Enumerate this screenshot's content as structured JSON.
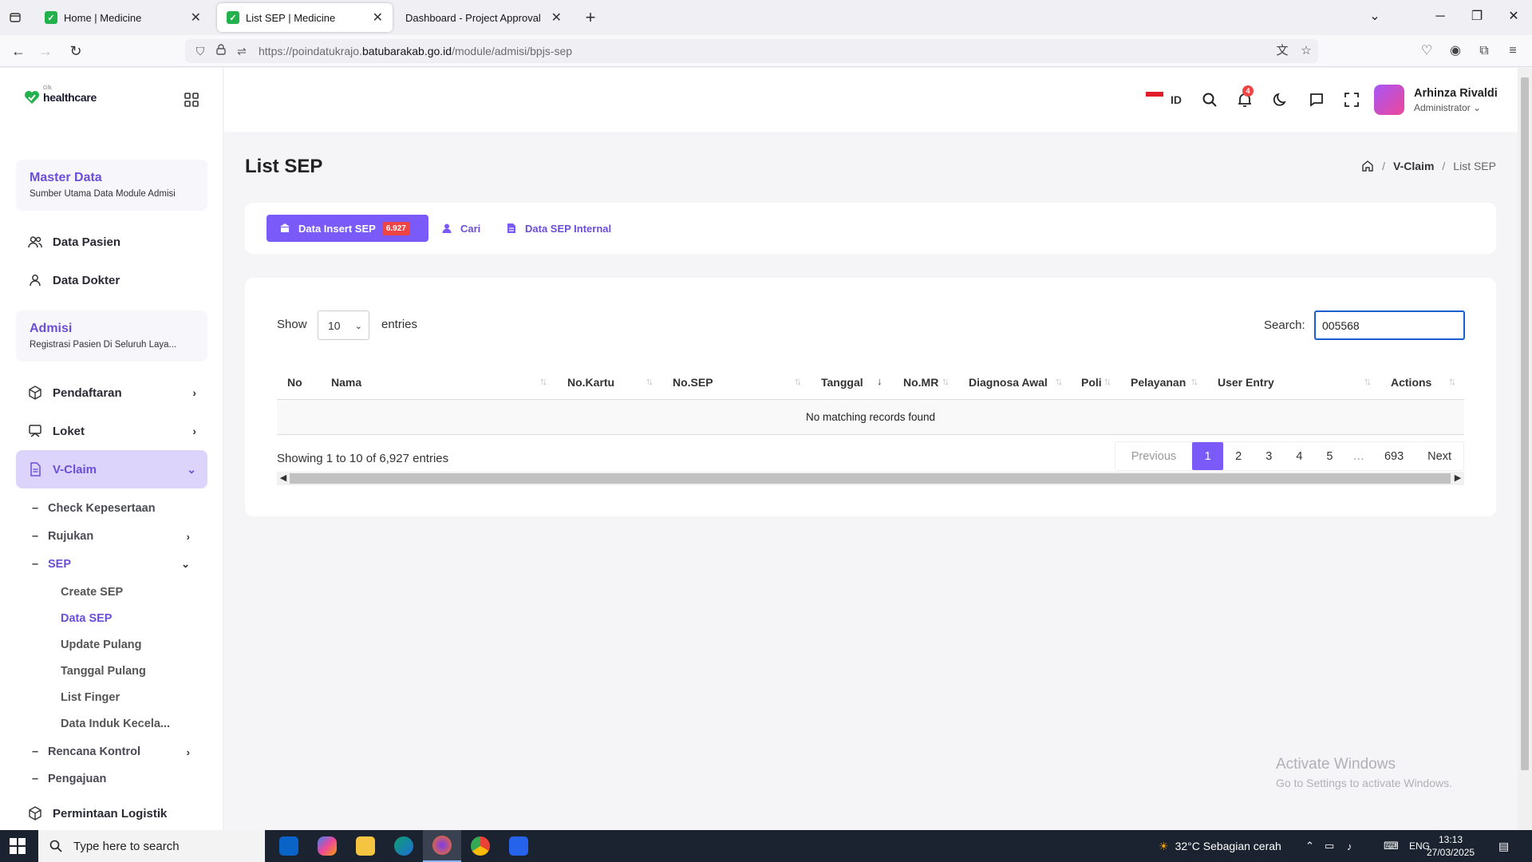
{
  "browser": {
    "tabs": [
      {
        "title": "Home | Medicine",
        "active": false
      },
      {
        "title": "List SEP | Medicine",
        "active": true
      },
      {
        "title": "Dashboard - Project Approval",
        "active": false
      }
    ],
    "url_prefix": "https://poindatukrajo.",
    "url_domain": "batubarakab.go.id",
    "url_path": "/module/admisi/bpjs-sep"
  },
  "brand": {
    "sup": "Gfk",
    "name": "healthcare"
  },
  "sidebar": {
    "master": {
      "title": "Master Data",
      "subtitle": "Sumber Utama Data Module Admisi"
    },
    "master_items": [
      "Data Pasien",
      "Data Dokter"
    ],
    "admisi": {
      "title": "Admisi",
      "subtitle": "Registrasi Pasien Di Seluruh Laya..."
    },
    "admisi_items": [
      "Pendaftaran",
      "Loket",
      "V-Claim"
    ],
    "vclaim_items": [
      "Check Kepesertaan",
      "Rujukan",
      "SEP"
    ],
    "sep_items": [
      "Create SEP",
      "Data SEP",
      "Update Pulang",
      "Tanggal Pulang",
      "List Finger",
      "Data Induk Kecela..."
    ],
    "more_items": [
      "Rencana Kontrol",
      "Pengajuan"
    ],
    "logistik": "Permintaan Logistik"
  },
  "topbar": {
    "lang": "ID",
    "notif_count": "4",
    "user_name": "Arhinza Rivaldi",
    "user_role": "Administrator"
  },
  "page": {
    "title": "List SEP",
    "breadcrumb": [
      "V-Claim",
      "List SEP"
    ]
  },
  "actions": {
    "insert_label": "Data Insert SEP",
    "insert_count": "6.927",
    "cari_label": "Cari",
    "internal_label": "Data SEP Internal"
  },
  "table": {
    "show_label": "Show",
    "page_size": "10",
    "entries_label": "entries",
    "search_label": "Search:",
    "search_value": "005568",
    "columns": [
      "No",
      "Nama",
      "No.Kartu",
      "No.SEP",
      "Tanggal",
      "No.MR",
      "Diagnosa Awal",
      "Poli",
      "Pelayanan",
      "User Entry",
      "Actions"
    ],
    "empty_message": "No matching records found",
    "info": "Showing 1 to 10 of 6,927 entries",
    "pagination": [
      "Previous",
      "1",
      "2",
      "3",
      "4",
      "5",
      "…",
      "693",
      "Next"
    ]
  },
  "watermark": {
    "line1": "Activate Windows",
    "line2": "Go to Settings to activate Windows."
  },
  "taskbar": {
    "search_placeholder": "Type here to search",
    "weather": "32°C  Sebagian cerah",
    "lang": "ENG",
    "time": "13:13",
    "date": "27/03/2025"
  },
  "colors": {
    "accent": "#7a5af8",
    "danger": "#ef4444",
    "brand_green": "#22b14c"
  }
}
